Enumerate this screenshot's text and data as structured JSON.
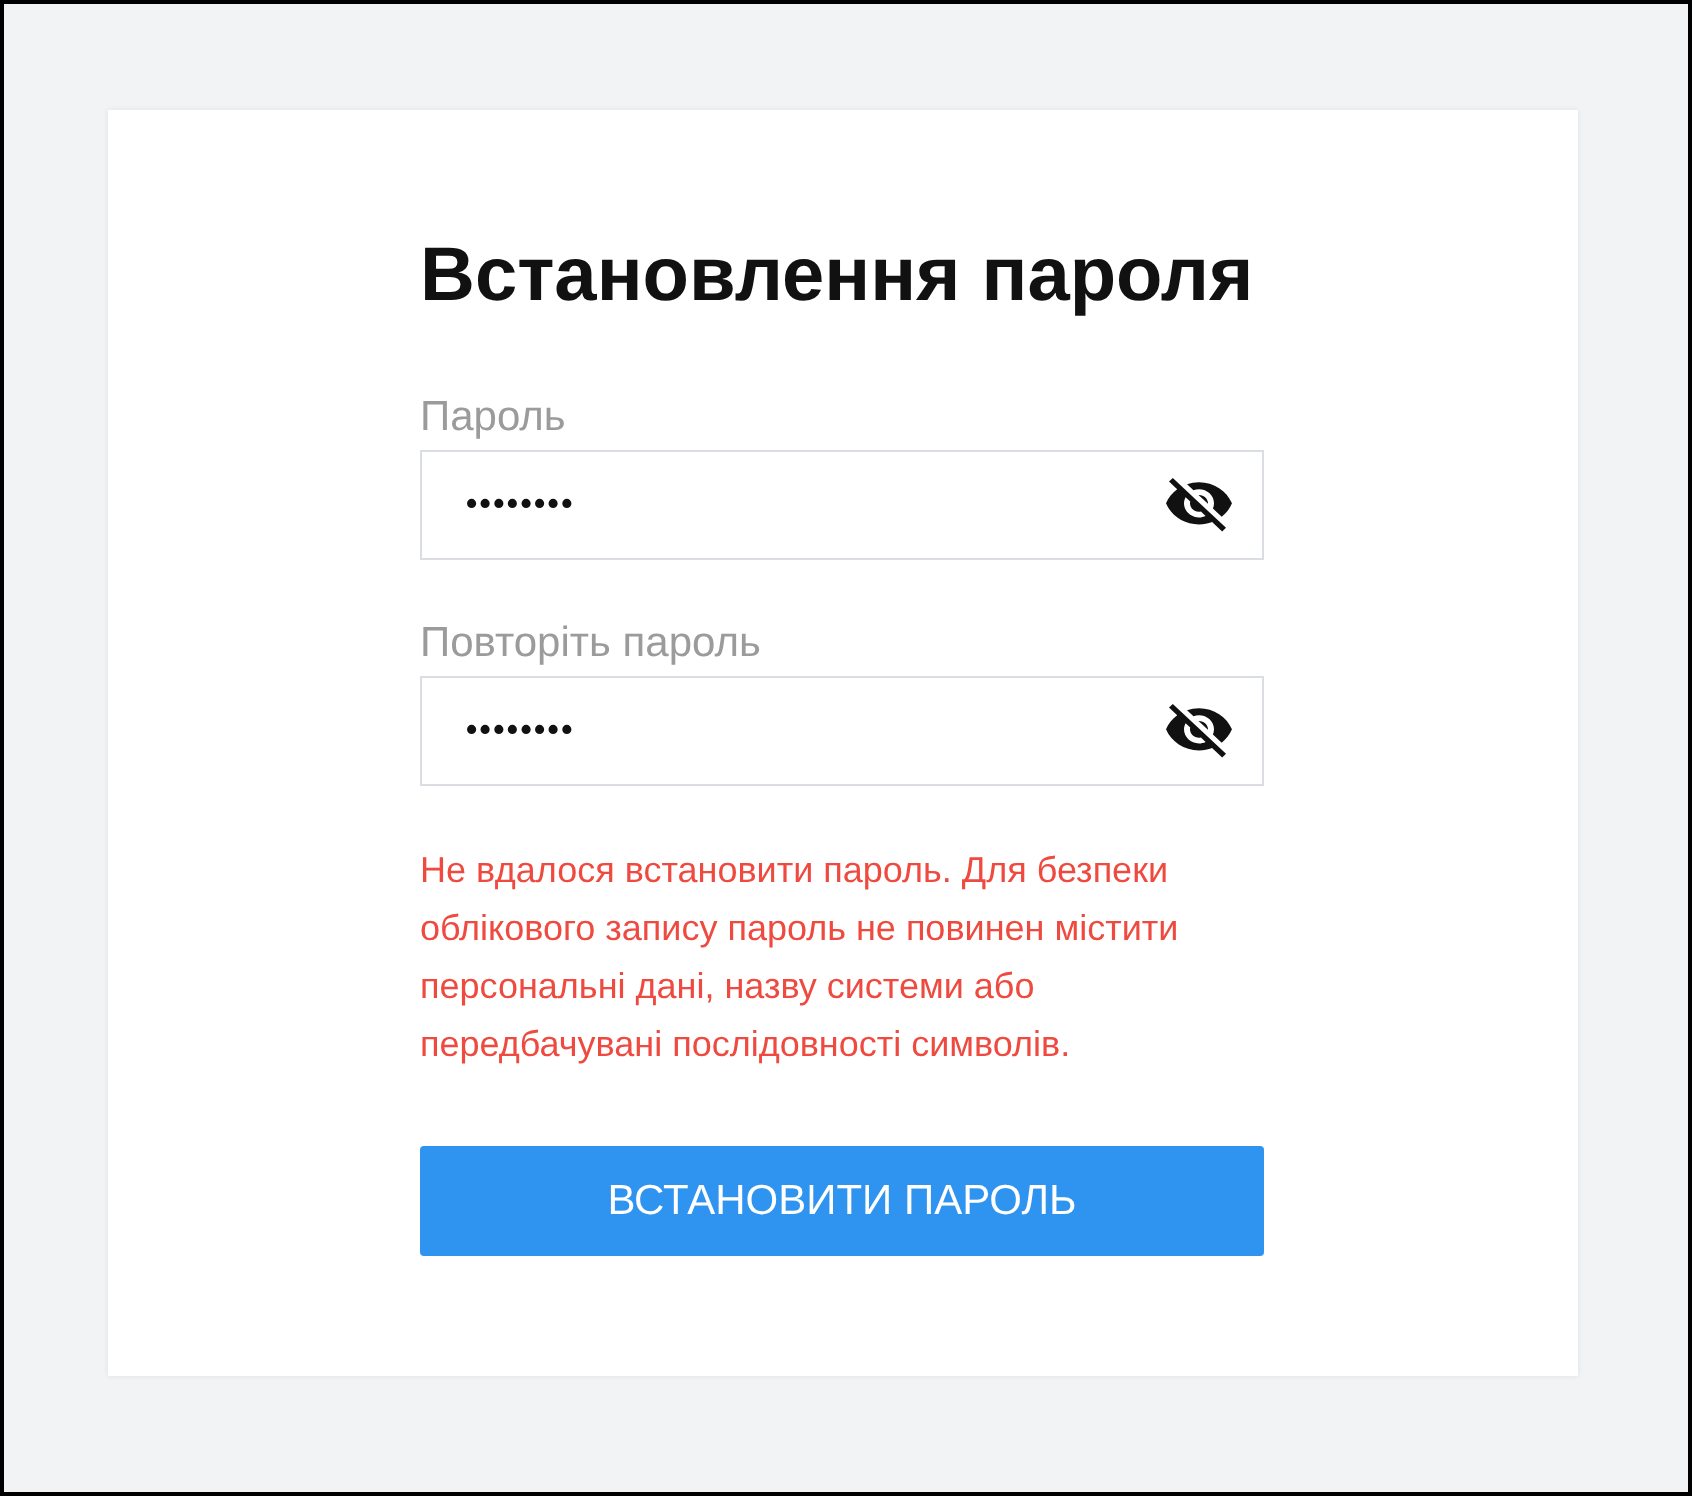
{
  "title": "Встановлення пароля",
  "fields": [
    {
      "label": "Пароль",
      "value": "••••••••",
      "visible": false
    },
    {
      "label": "Повторіть пароль",
      "value": "••••••••",
      "visible": false
    }
  ],
  "error": "Не вдалося встановити пароль. Для безпеки облікового запису пароль не повинен містити персональні дані, назву системи або передбачувані послідовності символів.",
  "submit_button": "ВСТАНОВИТИ ПАРОЛЬ"
}
